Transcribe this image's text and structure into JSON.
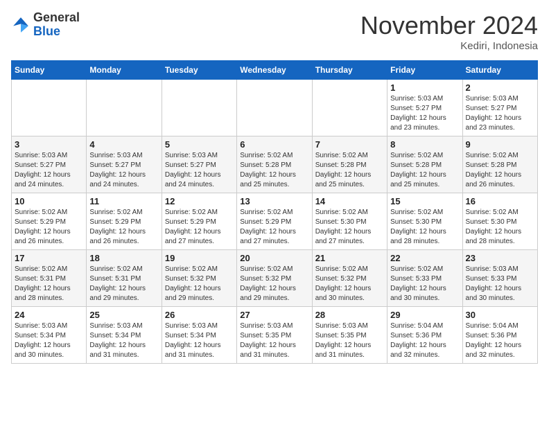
{
  "header": {
    "logo": {
      "general": "General",
      "blue": "Blue"
    },
    "title": "November 2024",
    "subtitle": "Kediri, Indonesia"
  },
  "calendar": {
    "weekdays": [
      "Sunday",
      "Monday",
      "Tuesday",
      "Wednesday",
      "Thursday",
      "Friday",
      "Saturday"
    ],
    "weeks": [
      [
        {
          "day": "",
          "sunrise": "",
          "sunset": "",
          "daylight": ""
        },
        {
          "day": "",
          "sunrise": "",
          "sunset": "",
          "daylight": ""
        },
        {
          "day": "",
          "sunrise": "",
          "sunset": "",
          "daylight": ""
        },
        {
          "day": "",
          "sunrise": "",
          "sunset": "",
          "daylight": ""
        },
        {
          "day": "",
          "sunrise": "",
          "sunset": "",
          "daylight": ""
        },
        {
          "day": "1",
          "sunrise": "Sunrise: 5:03 AM",
          "sunset": "Sunset: 5:27 PM",
          "daylight": "Daylight: 12 hours and 23 minutes."
        },
        {
          "day": "2",
          "sunrise": "Sunrise: 5:03 AM",
          "sunset": "Sunset: 5:27 PM",
          "daylight": "Daylight: 12 hours and 23 minutes."
        }
      ],
      [
        {
          "day": "3",
          "sunrise": "Sunrise: 5:03 AM",
          "sunset": "Sunset: 5:27 PM",
          "daylight": "Daylight: 12 hours and 24 minutes."
        },
        {
          "day": "4",
          "sunrise": "Sunrise: 5:03 AM",
          "sunset": "Sunset: 5:27 PM",
          "daylight": "Daylight: 12 hours and 24 minutes."
        },
        {
          "day": "5",
          "sunrise": "Sunrise: 5:03 AM",
          "sunset": "Sunset: 5:27 PM",
          "daylight": "Daylight: 12 hours and 24 minutes."
        },
        {
          "day": "6",
          "sunrise": "Sunrise: 5:02 AM",
          "sunset": "Sunset: 5:28 PM",
          "daylight": "Daylight: 12 hours and 25 minutes."
        },
        {
          "day": "7",
          "sunrise": "Sunrise: 5:02 AM",
          "sunset": "Sunset: 5:28 PM",
          "daylight": "Daylight: 12 hours and 25 minutes."
        },
        {
          "day": "8",
          "sunrise": "Sunrise: 5:02 AM",
          "sunset": "Sunset: 5:28 PM",
          "daylight": "Daylight: 12 hours and 25 minutes."
        },
        {
          "day": "9",
          "sunrise": "Sunrise: 5:02 AM",
          "sunset": "Sunset: 5:28 PM",
          "daylight": "Daylight: 12 hours and 26 minutes."
        }
      ],
      [
        {
          "day": "10",
          "sunrise": "Sunrise: 5:02 AM",
          "sunset": "Sunset: 5:29 PM",
          "daylight": "Daylight: 12 hours and 26 minutes."
        },
        {
          "day": "11",
          "sunrise": "Sunrise: 5:02 AM",
          "sunset": "Sunset: 5:29 PM",
          "daylight": "Daylight: 12 hours and 26 minutes."
        },
        {
          "day": "12",
          "sunrise": "Sunrise: 5:02 AM",
          "sunset": "Sunset: 5:29 PM",
          "daylight": "Daylight: 12 hours and 27 minutes."
        },
        {
          "day": "13",
          "sunrise": "Sunrise: 5:02 AM",
          "sunset": "Sunset: 5:29 PM",
          "daylight": "Daylight: 12 hours and 27 minutes."
        },
        {
          "day": "14",
          "sunrise": "Sunrise: 5:02 AM",
          "sunset": "Sunset: 5:30 PM",
          "daylight": "Daylight: 12 hours and 27 minutes."
        },
        {
          "day": "15",
          "sunrise": "Sunrise: 5:02 AM",
          "sunset": "Sunset: 5:30 PM",
          "daylight": "Daylight: 12 hours and 28 minutes."
        },
        {
          "day": "16",
          "sunrise": "Sunrise: 5:02 AM",
          "sunset": "Sunset: 5:30 PM",
          "daylight": "Daylight: 12 hours and 28 minutes."
        }
      ],
      [
        {
          "day": "17",
          "sunrise": "Sunrise: 5:02 AM",
          "sunset": "Sunset: 5:31 PM",
          "daylight": "Daylight: 12 hours and 28 minutes."
        },
        {
          "day": "18",
          "sunrise": "Sunrise: 5:02 AM",
          "sunset": "Sunset: 5:31 PM",
          "daylight": "Daylight: 12 hours and 29 minutes."
        },
        {
          "day": "19",
          "sunrise": "Sunrise: 5:02 AM",
          "sunset": "Sunset: 5:32 PM",
          "daylight": "Daylight: 12 hours and 29 minutes."
        },
        {
          "day": "20",
          "sunrise": "Sunrise: 5:02 AM",
          "sunset": "Sunset: 5:32 PM",
          "daylight": "Daylight: 12 hours and 29 minutes."
        },
        {
          "day": "21",
          "sunrise": "Sunrise: 5:02 AM",
          "sunset": "Sunset: 5:32 PM",
          "daylight": "Daylight: 12 hours and 30 minutes."
        },
        {
          "day": "22",
          "sunrise": "Sunrise: 5:02 AM",
          "sunset": "Sunset: 5:33 PM",
          "daylight": "Daylight: 12 hours and 30 minutes."
        },
        {
          "day": "23",
          "sunrise": "Sunrise: 5:03 AM",
          "sunset": "Sunset: 5:33 PM",
          "daylight": "Daylight: 12 hours and 30 minutes."
        }
      ],
      [
        {
          "day": "24",
          "sunrise": "Sunrise: 5:03 AM",
          "sunset": "Sunset: 5:34 PM",
          "daylight": "Daylight: 12 hours and 30 minutes."
        },
        {
          "day": "25",
          "sunrise": "Sunrise: 5:03 AM",
          "sunset": "Sunset: 5:34 PM",
          "daylight": "Daylight: 12 hours and 31 minutes."
        },
        {
          "day": "26",
          "sunrise": "Sunrise: 5:03 AM",
          "sunset": "Sunset: 5:34 PM",
          "daylight": "Daylight: 12 hours and 31 minutes."
        },
        {
          "day": "27",
          "sunrise": "Sunrise: 5:03 AM",
          "sunset": "Sunset: 5:35 PM",
          "daylight": "Daylight: 12 hours and 31 minutes."
        },
        {
          "day": "28",
          "sunrise": "Sunrise: 5:03 AM",
          "sunset": "Sunset: 5:35 PM",
          "daylight": "Daylight: 12 hours and 31 minutes."
        },
        {
          "day": "29",
          "sunrise": "Sunrise: 5:04 AM",
          "sunset": "Sunset: 5:36 PM",
          "daylight": "Daylight: 12 hours and 32 minutes."
        },
        {
          "day": "30",
          "sunrise": "Sunrise: 5:04 AM",
          "sunset": "Sunset: 5:36 PM",
          "daylight": "Daylight: 12 hours and 32 minutes."
        }
      ]
    ]
  }
}
